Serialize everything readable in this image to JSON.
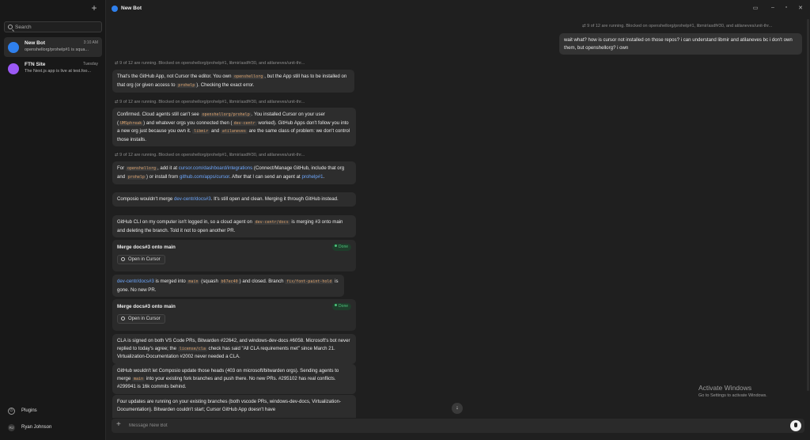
{
  "sidebar": {
    "new_chat_icon": "plus-icon",
    "search_placeholder": "Search",
    "chats": [
      {
        "title": "New Bot",
        "time": "3:10 AM",
        "preview": "openshellorg/prohelp#1 is squa...",
        "avatar_color": "#2f80ed"
      },
      {
        "title": "FTN Site",
        "time": "Tuesday",
        "preview": "The Next.js app is live at test.foo...",
        "avatar_color": "#9b59f5"
      }
    ],
    "plugins_label": "Plugins",
    "user_initials": "RJ",
    "user_name": "Ryan Johnson"
  },
  "header": {
    "title": "New Bot"
  },
  "conversation": {
    "status_line": "9 of 12 are running. Blocked on openshellorg/prohelp#1, libmir/asdf#30, and atilaneves/unit-thr...",
    "user_message": "wait what? how is cursor not installed on those repos? i can understand libmir and atilaneves bc i don't own them, but openshellorg? i own",
    "m1": {
      "t1": "That's the GitHub App, not Cursor the editor. You own ",
      "c1": "openshellorg",
      "t2": ", but the App still has to be installed on that org (or given access to ",
      "c2": "prohelp",
      "t3": "). Checking the exact error."
    },
    "m2": {
      "t1": "Confirmed. Cloud agents still can't see ",
      "c1": "openshellorg/prohelp",
      "t2": ". You installed Cursor on your user (",
      "c2": "UMSphreak",
      "t3": ") and whatever orgs you connected then (",
      "c3": "dev-centr",
      "t4": " worked). GitHub Apps don't follow you into a new org just because you own it. ",
      "c4": "libmir",
      "t5": " and ",
      "c5": "atilaneves",
      "t6": " are the same class of problem: we don't control those installs."
    },
    "m3": {
      "t1": "For ",
      "c1": "openshellorg",
      "t2": ", add it at ",
      "l1": "cursor.com/dashboard/integrations",
      "t3": " (Connect/Manage GitHub, include that org and ",
      "c2": "prohelp",
      "t4": ") or install from ",
      "l2": "github.com/apps/cursor",
      "t5": ". After that I can send an agent at ",
      "l3": "prohelp#1",
      "t6": "."
    },
    "m4": {
      "t1": "Composio wouldn't merge ",
      "l1": "dev-centr/docs#3",
      "t2": ". It's still open and clean. Merging it through GitHub instead."
    },
    "m5": {
      "t1": "GitHub CLI on my computer isn't logged in, so a cloud agent on ",
      "c1": "dev-centr/docs",
      "t2": " is merging #3 onto main and deleting the branch. Told it not to open another PR."
    },
    "card1": {
      "title": "Merge docs#3 onto main",
      "status": "Done",
      "button": "Open in Cursor"
    },
    "m6": {
      "l1": "dev-centr/docs#3",
      "t1": " is merged into ",
      "c1": "main",
      "t2": " (squash ",
      "c2": "b67ec40",
      "t3": ") and closed. Branch ",
      "c3": "fix/font-paint-hold",
      "t4": " is gone. No new PR."
    },
    "card2": {
      "title": "Merge docs#3 onto main",
      "status": "Done",
      "button": "Open in Cursor"
    },
    "m7": {
      "t1": "CLA is signed on both VS Code PRs, Bitwarden #22642, and windows-dev-docs #6058. Microsoft's bot never replied to today's agree; the ",
      "c1": "license/cla",
      "t2": " check has said \"All CLA requirements met\" since March 21. Virtualization-Documentation #2002 never needed a CLA."
    },
    "m8": {
      "t1": "GitHub wouldn't let Composio update those heads (403 on microsoft/bitwarden orgs). Sending agents to merge ",
      "c1": "main",
      "t2": " into your existing fork branches and push there. No new PRs. #295102 has real conflicts. #299941 is 16k commits behind."
    },
    "m9": {
      "t1": "Four updates are running on your existing branches (both vscode PRs, windows-dev-docs, Virtualization-Documentation). Bitwarden couldn't start; Cursor GitHub App doesn't have"
    }
  },
  "composer": {
    "placeholder": "Message New Bot"
  },
  "watermark": {
    "title": "Activate Windows",
    "subtitle": "Go to Settings to activate Windows."
  }
}
